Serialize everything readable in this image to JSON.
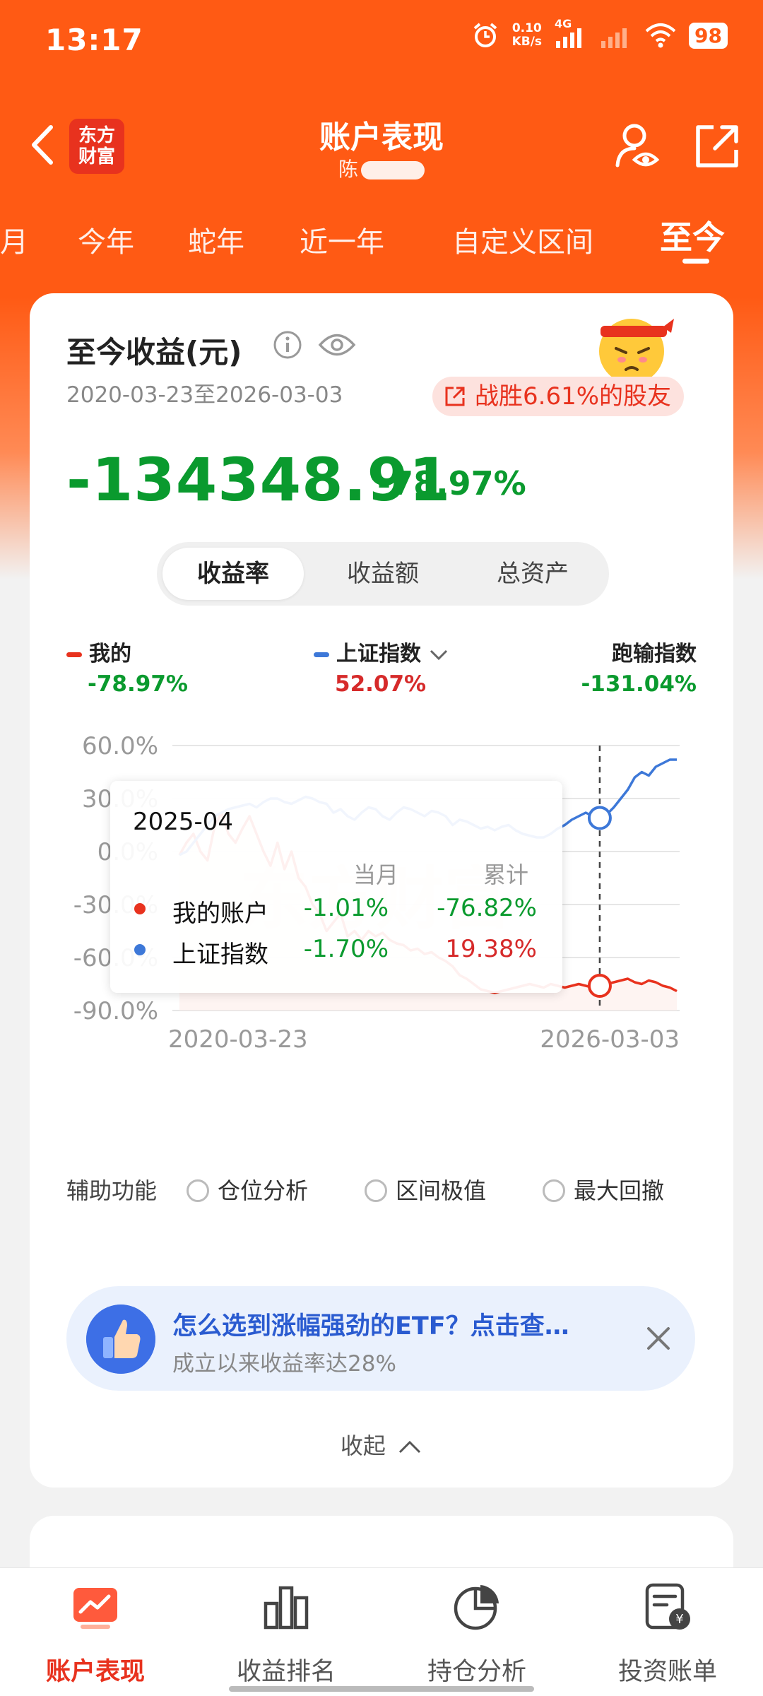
{
  "status_bar": {
    "time": "13:17",
    "net_speed": "0.10",
    "net_unit": "KB/s",
    "network": "4G",
    "battery": "98"
  },
  "header": {
    "logo_text": "东方\n财富",
    "title": "账户表现",
    "subtitle": "陈"
  },
  "period_tabs": [
    "月",
    "今年",
    "蛇年",
    "近一年",
    "自定义区间",
    "至今"
  ],
  "period_active": "至今",
  "summary": {
    "title": "至今收益(元)",
    "date_range": "2020-03-23至2026-03-03",
    "beat_text": "战胜6.61%的股友",
    "amount": "-134348.91",
    "percent": "-78.97%"
  },
  "metric_tabs": [
    "收益率",
    "收益额",
    "总资产"
  ],
  "metric_active": "收益率",
  "legend": {
    "mine_label": "我的",
    "mine_value": "-78.97%",
    "index_label": "上证指数",
    "index_value": "52.07%",
    "lag_label": "跑输指数",
    "lag_value": "-131.04%"
  },
  "colors": {
    "brand": "#ff5a14",
    "mine": "#e8321e",
    "index": "#3d78d8",
    "loss": "#0a9a2e",
    "gain": "#d62a2a"
  },
  "chart_data": {
    "type": "line",
    "ylim": [
      -90,
      60
    ],
    "y_ticks": [
      "60.0%",
      "30.0%",
      "0.0%",
      "-30.0%",
      "-60.0%",
      "-90.0%"
    ],
    "y_tick_values": [
      60,
      30,
      0,
      -30,
      -60,
      -90
    ],
    "x_start_label": "2020-03-23",
    "x_end_label": "2026-03-03",
    "x_count": 72,
    "series": [
      {
        "name": "我的",
        "values": [
          -2,
          5,
          10,
          0,
          -5,
          14,
          22,
          10,
          5,
          13,
          20,
          10,
          0,
          -8,
          5,
          -10,
          0,
          -15,
          -20,
          -30,
          -35,
          -45,
          -40,
          -35,
          -48,
          -45,
          -50,
          -45,
          -48,
          -46,
          -50,
          -52,
          -53,
          -56,
          -55,
          -58,
          -57,
          -60,
          -62,
          -65,
          -70,
          -72,
          -75,
          -78,
          -79,
          -80,
          -79,
          -78,
          -77,
          -76,
          -75,
          -76,
          -77,
          -75,
          -76,
          -77,
          -76,
          -75,
          -76,
          -77,
          -76,
          -75,
          -74,
          -73,
          -72,
          -74,
          -75,
          -73,
          -74,
          -76,
          -77,
          -79
        ]
      },
      {
        "name": "上证指数",
        "values": [
          -2,
          0,
          5,
          10,
          15,
          20,
          22,
          24,
          25,
          26,
          27,
          25,
          28,
          30,
          30,
          28,
          27,
          29,
          31,
          30,
          28,
          27,
          22,
          24,
          20,
          18,
          22,
          25,
          24,
          20,
          18,
          22,
          25,
          24,
          22,
          20,
          23,
          22,
          20,
          15,
          18,
          17,
          15,
          13,
          14,
          12,
          14,
          15,
          12,
          10,
          9,
          8,
          8,
          10,
          13,
          15,
          18,
          20,
          22,
          20,
          19,
          21,
          25,
          30,
          35,
          42,
          45,
          43,
          48,
          50,
          52,
          52
        ]
      }
    ],
    "tooltip": {
      "month": "2025-04",
      "col_month": "当月",
      "col_total": "累计",
      "rows": [
        {
          "name": "我的账户",
          "month": "-1.01%",
          "total": "-76.82%"
        },
        {
          "name": "上证指数",
          "month": "-1.70%",
          "total": "19.38%"
        }
      ]
    },
    "watermark": "东方财富"
  },
  "aux": {
    "label": "辅助功能",
    "options": [
      "仓位分析",
      "区间极值",
      "最大回撤"
    ]
  },
  "promo": {
    "title": "怎么选到涨幅强劲的ETF？点击查…",
    "subtitle": "成立以来收益率达28%"
  },
  "collapse_label": "收起",
  "bottom_nav": [
    {
      "label": "账户表现",
      "icon": "chart-icon"
    },
    {
      "label": "收益排名",
      "icon": "bar-chart-icon"
    },
    {
      "label": "持仓分析",
      "icon": "pie-chart-icon"
    },
    {
      "label": "投资账单",
      "icon": "bill-icon"
    }
  ]
}
